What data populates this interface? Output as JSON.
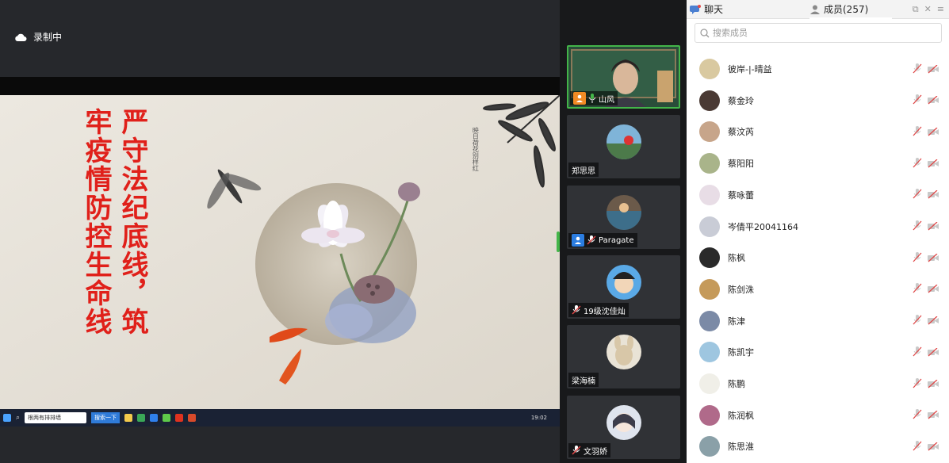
{
  "recording": {
    "label": "录制中"
  },
  "slide": {
    "line_right": "严守法纪底线，筑",
    "line_left": "牢疫情防控生命线",
    "poem": "映日荷花别样红"
  },
  "taskbar": {
    "search_text": "根两有排排墙",
    "button_label": "搜索一下",
    "clock": "19:02"
  },
  "videos": [
    {
      "name": "山风",
      "role": "host",
      "active": true
    },
    {
      "name": "郑思思",
      "role": "none",
      "active": false
    },
    {
      "name": "Paragate",
      "role": "cohost",
      "active": false
    },
    {
      "name": "19级沈佳灿",
      "role": "muted",
      "active": false
    },
    {
      "name": "梁海楠",
      "role": "none",
      "active": false
    },
    {
      "name": "文羽娇",
      "role": "muted",
      "active": false
    }
  ],
  "panel": {
    "tab_chat": "聊天",
    "tab_members": "成员(257)",
    "search_placeholder": "搜索成员"
  },
  "members": [
    {
      "name": "彼岸-|-晴益"
    },
    {
      "name": "蔡金玲"
    },
    {
      "name": "蔡汶芮"
    },
    {
      "name": "蔡阳阳"
    },
    {
      "name": "蔡咏蕾"
    },
    {
      "name": "岑倩平20041164"
    },
    {
      "name": "陈枫"
    },
    {
      "name": "陈剑洙"
    },
    {
      "name": "陈津"
    },
    {
      "name": "陈凯宇"
    },
    {
      "name": "陈鹏"
    },
    {
      "name": "陈润枫"
    },
    {
      "name": "陈思淮"
    }
  ],
  "colors": {
    "accent_green": "#43b549",
    "host_orange": "#f08a24",
    "cohost_blue": "#2b7de1",
    "slogan_red": "#e0201a",
    "muted_red": "#e04848"
  }
}
